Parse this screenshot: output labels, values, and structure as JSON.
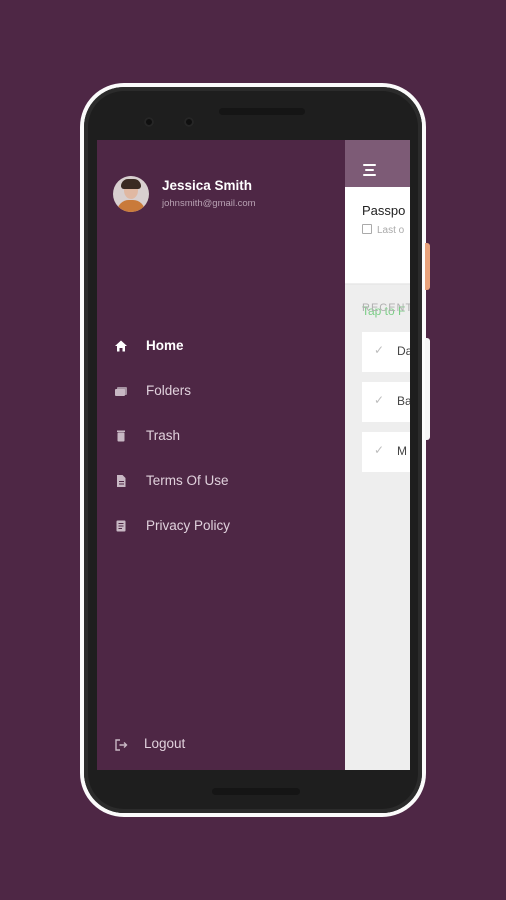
{
  "colors": {
    "background": "#4e2745",
    "drawer": "#4e2745",
    "app_header": "#7d5b76",
    "link_green": "#7ccd87"
  },
  "drawer": {
    "user": {
      "name": "Jessica Smith",
      "email": "johnsmith@gmail.com"
    },
    "items": [
      {
        "label": "Home",
        "icon": "home-icon",
        "active": true
      },
      {
        "label": "Folders",
        "icon": "folder-icon",
        "active": false
      },
      {
        "label": "Trash",
        "icon": "trash-icon",
        "active": false
      },
      {
        "label": "Terms Of Use",
        "icon": "document-icon",
        "active": false
      },
      {
        "label": "Privacy Policy",
        "icon": "policy-icon",
        "active": false
      }
    ],
    "logout_label": "Logout"
  },
  "app": {
    "menu_icon": "menu-icon",
    "card": {
      "title": "Passpo",
      "subtitle": "Last o",
      "link": "Tap to F"
    },
    "recent_label": "RECENT",
    "recent_items": [
      {
        "text": "Da"
      },
      {
        "text": "Ba"
      },
      {
        "text": "M"
      }
    ]
  }
}
